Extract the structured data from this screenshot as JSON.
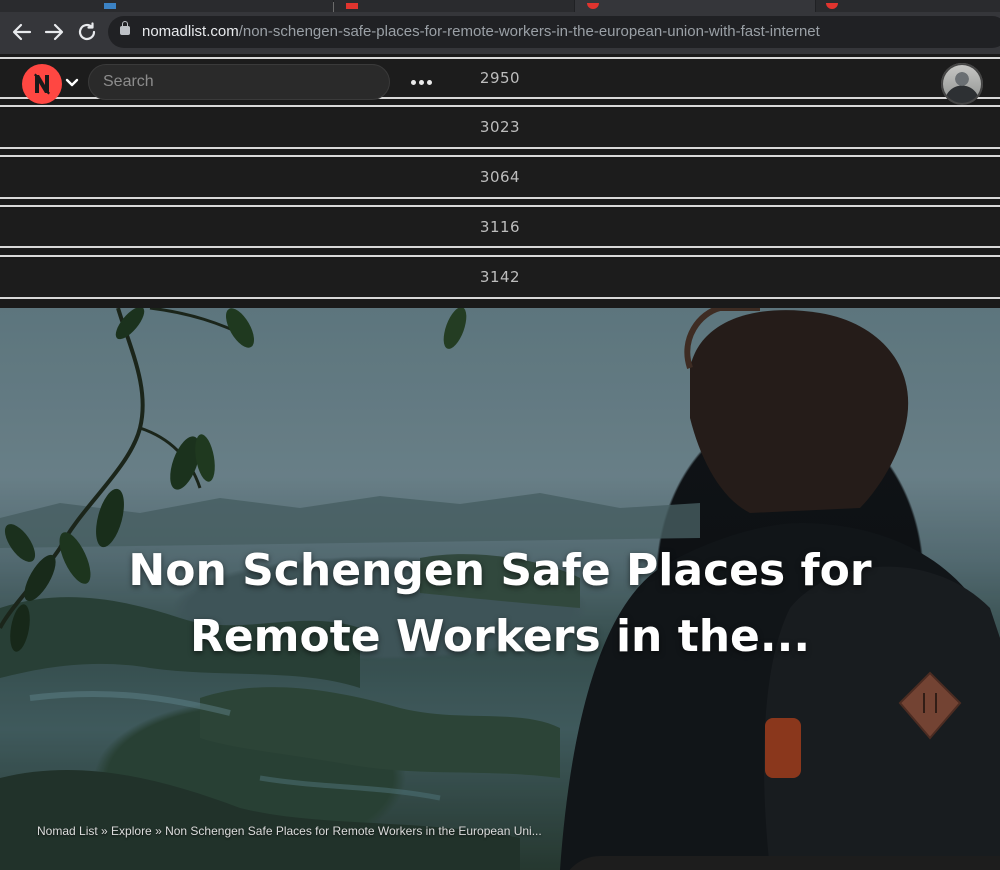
{
  "browser": {
    "url_host": "nomadlist.com",
    "url_path": "/non-schengen-safe-places-for-remote-workers-in-the-european-union-with-fast-internet"
  },
  "header": {
    "search_placeholder": "Search"
  },
  "dropdown": {
    "items": [
      "2950",
      "3023",
      "3064",
      "3116",
      "3142"
    ]
  },
  "hero": {
    "title_line1": "Non Schengen Safe Places for",
    "title_line2": "Remote Workers in the..."
  },
  "breadcrumb": {
    "home": "Nomad List",
    "sep1": " » ",
    "explore": "Explore",
    "sep2": " » ",
    "current": "Non Schengen Safe Places for Remote Workers in the European Uni..."
  },
  "colors": {
    "brand": "#ff4742",
    "header_bg": "#1c1c1c",
    "chrome_bg": "#35363a"
  },
  "icons": [
    "back-arrow-icon",
    "forward-arrow-icon",
    "reload-icon",
    "lock-icon",
    "nomad-logo-icon",
    "chevron-down-icon",
    "more-dots-icon",
    "avatar"
  ]
}
